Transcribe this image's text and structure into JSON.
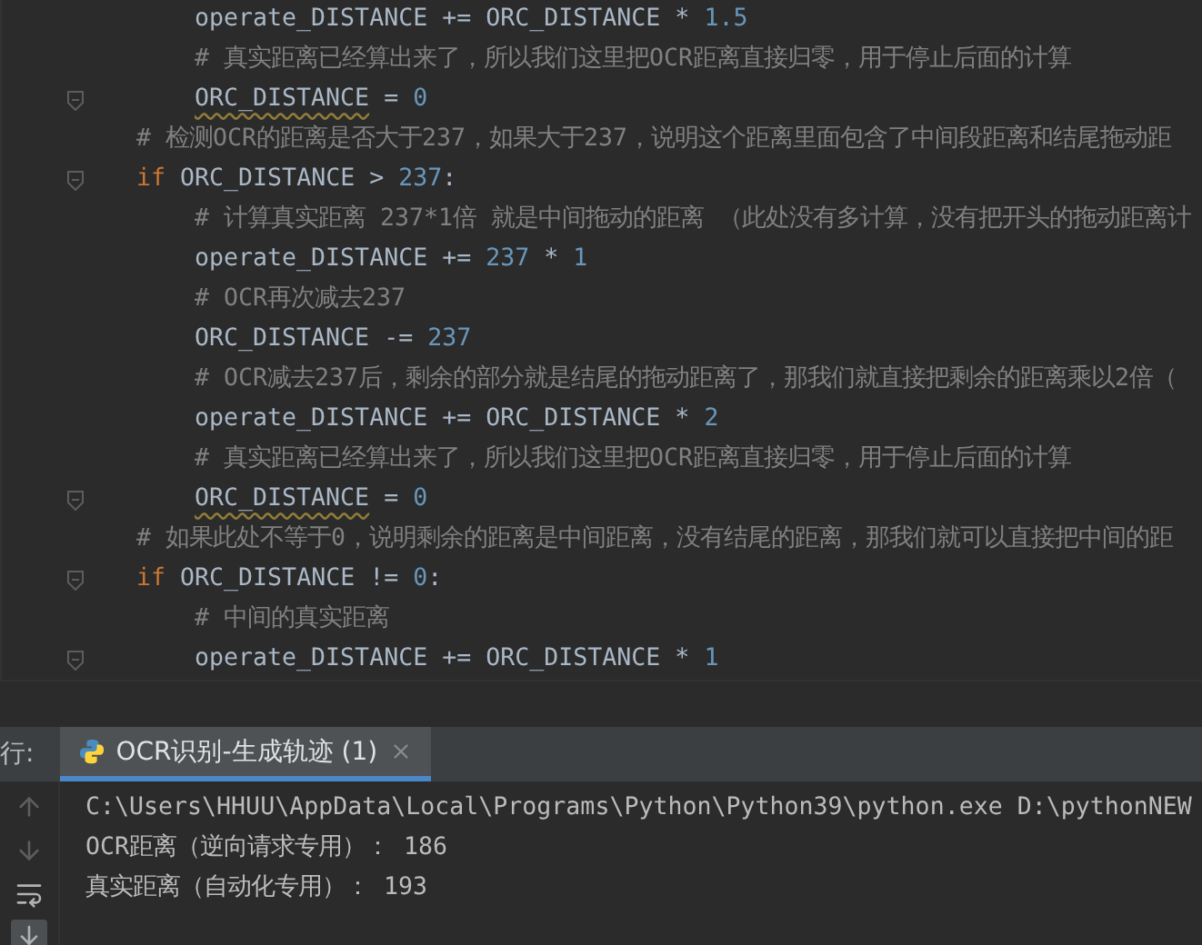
{
  "editor": {
    "lines": [
      {
        "children": [
          {
            "fold": false,
            "tokens": [
              {
                "kind": "ident",
                "text": "operate_DISTANCE += ORC_DISTANCE * "
              },
              {
                "kind": "number",
                "text": "1.5"
              }
            ]
          },
          {
            "fold": false,
            "tokens": [
              {
                "kind": "comment",
                "text": "# 真实距离已经算出来了，所以我们这里把OCR距离直接归零，用于停止后面的计算"
              }
            ]
          },
          {
            "fold": true,
            "tokens": [
              {
                "kind": "warning",
                "text": "ORC_DISTANCE"
              },
              {
                "kind": "ident",
                "text": " = "
              },
              {
                "kind": "number",
                "text": "0"
              }
            ]
          }
        ]
      },
      {
        "fold": false,
        "tokens": [
          {
            "kind": "comment",
            "text": "# 检测OCR的距离是否大于237，如果大于237，说明这个距离里面包含了中间段距离和结尾拖动距"
          }
        ]
      },
      {
        "fold": true,
        "tokens": [
          {
            "kind": "keyword",
            "text": "if"
          },
          {
            "kind": "ident",
            "text": " ORC_DISTANCE > "
          },
          {
            "kind": "number",
            "text": "237"
          },
          {
            "kind": "ident",
            "text": ":"
          }
        ],
        "children": [
          {
            "fold": false,
            "tokens": [
              {
                "kind": "comment",
                "text": "# 计算真实距离 237*1倍 就是中间拖动的距离 （此处没有多计算，没有把开头的拖动距离计"
              }
            ]
          },
          {
            "fold": false,
            "tokens": [
              {
                "kind": "ident",
                "text": "operate_DISTANCE += "
              },
              {
                "kind": "number",
                "text": "237"
              },
              {
                "kind": "ident",
                "text": " * "
              },
              {
                "kind": "number",
                "text": "1"
              }
            ]
          },
          {
            "fold": false,
            "tokens": [
              {
                "kind": "comment",
                "text": "# OCR再次减去237"
              }
            ]
          },
          {
            "fold": false,
            "tokens": [
              {
                "kind": "ident",
                "text": "ORC_DISTANCE -= "
              },
              {
                "kind": "number",
                "text": "237"
              }
            ]
          },
          {
            "fold": false,
            "tokens": [
              {
                "kind": "comment",
                "text": "# OCR减去237后，剩余的部分就是结尾的拖动距离了，那我们就直接把剩余的距离乘以2倍（"
              }
            ]
          },
          {
            "fold": false,
            "tokens": [
              {
                "kind": "ident",
                "text": "operate_DISTANCE += ORC_DISTANCE * "
              },
              {
                "kind": "number",
                "text": "2"
              }
            ]
          },
          {
            "fold": false,
            "tokens": [
              {
                "kind": "comment",
                "text": "# 真实距离已经算出来了，所以我们这里把OCR距离直接归零，用于停止后面的计算"
              }
            ]
          },
          {
            "fold": true,
            "tokens": [
              {
                "kind": "warning",
                "text": "ORC_DISTANCE"
              },
              {
                "kind": "ident",
                "text": " = "
              },
              {
                "kind": "number",
                "text": "0"
              }
            ]
          }
        ]
      },
      {
        "fold": false,
        "tokens": [
          {
            "kind": "comment",
            "text": "# 如果此处不等于0，说明剩余的距离是中间距离，没有结尾的距离，那我们就可以直接把中间的距"
          }
        ]
      },
      {
        "fold": true,
        "tokens": [
          {
            "kind": "keyword",
            "text": "if"
          },
          {
            "kind": "ident",
            "text": " ORC_DISTANCE != "
          },
          {
            "kind": "number",
            "text": "0"
          },
          {
            "kind": "ident",
            "text": ":"
          }
        ],
        "children": [
          {
            "fold": false,
            "tokens": [
              {
                "kind": "comment",
                "text": "# 中间的真实距离"
              }
            ]
          },
          {
            "fold": true,
            "tokens": [
              {
                "kind": "ident",
                "text": "operate_DISTANCE += ORC_DISTANCE * "
              },
              {
                "kind": "number",
                "text": "1"
              }
            ]
          }
        ]
      }
    ]
  },
  "run_panel": {
    "label": "行:",
    "tabs": [
      {
        "label": "OCR识别-生成轨迹 (1)",
        "selected": true
      }
    ],
    "output": [
      "C:\\Users\\HHUU\\AppData\\Local\\Programs\\Python\\Python39\\python.exe D:\\pythonNEW",
      "OCR距离（逆向请求专用）： 186",
      "真实距离（自动化专用）： 193"
    ]
  }
}
